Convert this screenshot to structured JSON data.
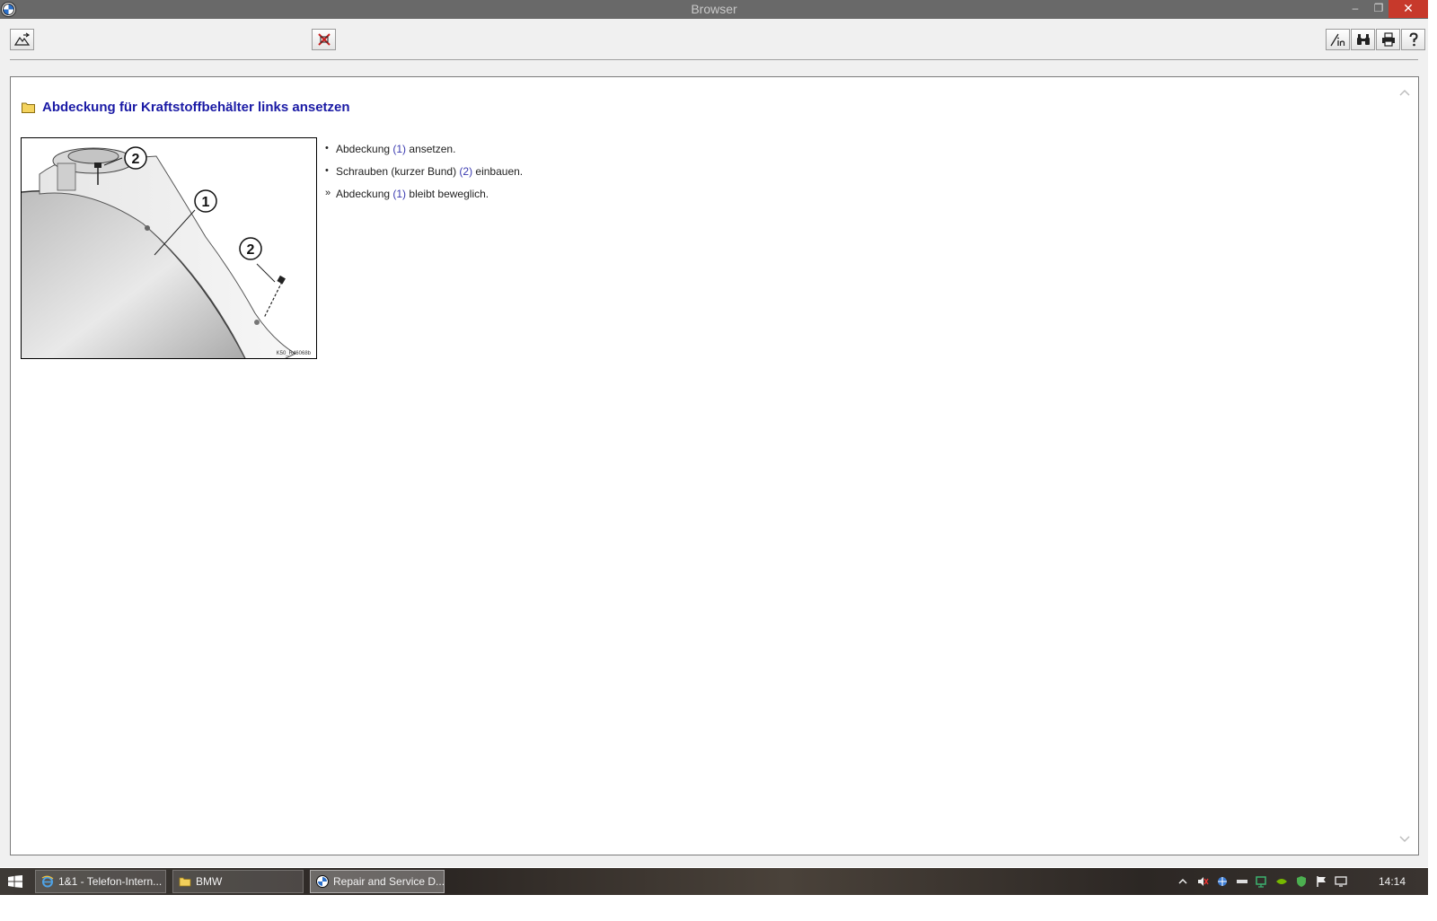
{
  "window": {
    "title": "Browser"
  },
  "titlebar_buttons": {
    "minimize": "–",
    "maximize": "❐",
    "close": "✕"
  },
  "toolbar": {
    "left_buttons": [
      {
        "icon": "mountain-pen-icon"
      },
      {
        "icon": "red-cancel-icon"
      }
    ],
    "right_buttons": [
      {
        "icon": "info-pen-icon"
      },
      {
        "icon": "binoculars-icon"
      },
      {
        "icon": "printer-icon"
      },
      {
        "icon": "help-icon"
      }
    ]
  },
  "document": {
    "heading": "Abdeckung für Kraftstoffbehälter links ansetzen",
    "figure": {
      "callouts": [
        "2",
        "1",
        "2"
      ],
      "reference": "K50_R46068b"
    },
    "steps": [
      {
        "bullet": "•",
        "before": "Abdeckung ",
        "ref": "(1)",
        "after": " ansetzen."
      },
      {
        "bullet": "•",
        "before": "Schrauben (kurzer Bund) ",
        "ref": "(2)",
        "after": " einbauen."
      },
      {
        "bullet": "»",
        "before": "Abdeckung ",
        "ref": "(1)",
        "after": " bleibt beweglich."
      }
    ]
  },
  "taskbar": {
    "buttons": [
      {
        "label": "1&1 - Telefon-Intern...",
        "icon": "internet-explorer-icon",
        "active": false
      },
      {
        "label": "BMW",
        "icon": "folder-icon",
        "active": false
      },
      {
        "label": "Repair and Service D...",
        "icon": "bmw-logo-icon",
        "active": true
      }
    ],
    "clock": "14:14"
  },
  "colors": {
    "heading": "#1a1aa5",
    "titlebar": "#696969",
    "close_button": "#c7392b",
    "reference_link": "#3a3ab0"
  }
}
